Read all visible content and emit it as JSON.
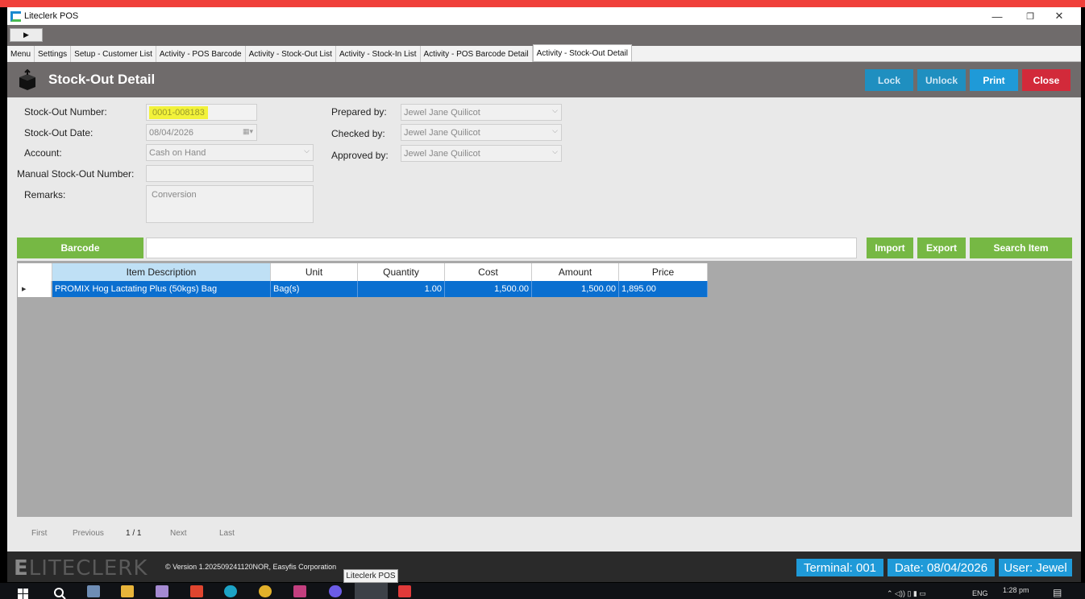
{
  "window": {
    "title": "Liteclerk POS",
    "minimize_glyph": "—",
    "maximize_glyph": "❐",
    "close_glyph": "✕"
  },
  "toolstrip": {
    "play_glyph": "▶"
  },
  "tabs": [
    {
      "label": "Menu"
    },
    {
      "label": "Settings"
    },
    {
      "label": "Setup - Customer List"
    },
    {
      "label": "Activity - POS Barcode"
    },
    {
      "label": "Activity - Stock-Out List"
    },
    {
      "label": "Activity - Stock-In List"
    },
    {
      "label": "Activity - POS Barcode Detail"
    },
    {
      "label": "Activity - Stock-Out Detail",
      "active": true
    }
  ],
  "header": {
    "title": "Stock-Out Detail",
    "icon": "box-icon",
    "buttons": {
      "lock": "Lock",
      "unlock": "Unlock",
      "print": "Print",
      "close": "Close"
    }
  },
  "form": {
    "stockout_number": {
      "label": "Stock-Out Number:",
      "value": "0001-008183"
    },
    "stockout_date": {
      "label": "Stock-Out Date:",
      "value": "08/04/2026"
    },
    "account": {
      "label": "Account:",
      "value": "Cash on Hand"
    },
    "manual_number": {
      "label": "Manual Stock-Out Number:",
      "value": ""
    },
    "remarks": {
      "label": "Remarks:",
      "value": "Conversion"
    },
    "prepared_by": {
      "label": "Prepared by:",
      "value": "Jewel Jane Quilicot"
    },
    "checked_by": {
      "label": "Checked by:",
      "value": "Jewel Jane Quilicot"
    },
    "approved_by": {
      "label": "Approved by:",
      "value": "Jewel Jane Quilicot"
    }
  },
  "barcode_bar": {
    "barcode_label": "Barcode",
    "import_label": "Import",
    "export_label": "Export",
    "search_label": "Search Item"
  },
  "grid": {
    "columns": [
      "Item Description",
      "Unit",
      "Quantity",
      "Cost",
      "Amount",
      "Price"
    ],
    "rows": [
      {
        "marker": "▶",
        "item_description": "PROMIX Hog Lactating Plus (50kgs) Bag",
        "unit": "Bag(s)",
        "quantity": "1.00",
        "cost": "1,500.00",
        "amount": "1,500.00",
        "price": "1,895.00"
      }
    ]
  },
  "pager": {
    "first": "First",
    "previous": "Previous",
    "page": "1 / 1",
    "next": "Next",
    "last": "Last"
  },
  "footer": {
    "logo_first": "E",
    "logo_rest": "LITECLERK",
    "version": "© Version 1.202509241120NOR, Easyfis Corporation",
    "terminal": "Terminal: 001",
    "date": "Date: 08/04/2026",
    "user": "User: Jewel"
  },
  "taskbar": {
    "tooltip": "Liteclerk POS",
    "language": "ENG",
    "time": "1:28 pm"
  },
  "colors": {
    "header_bg": "#6f6b6b",
    "lock_btn": "#1f8fc0",
    "print_btn": "#1f9ad8",
    "close_btn": "#d22a3a",
    "green_btn": "#76b844",
    "grid_selection": "#0a6fd0",
    "highlight": "#f2f23a"
  }
}
